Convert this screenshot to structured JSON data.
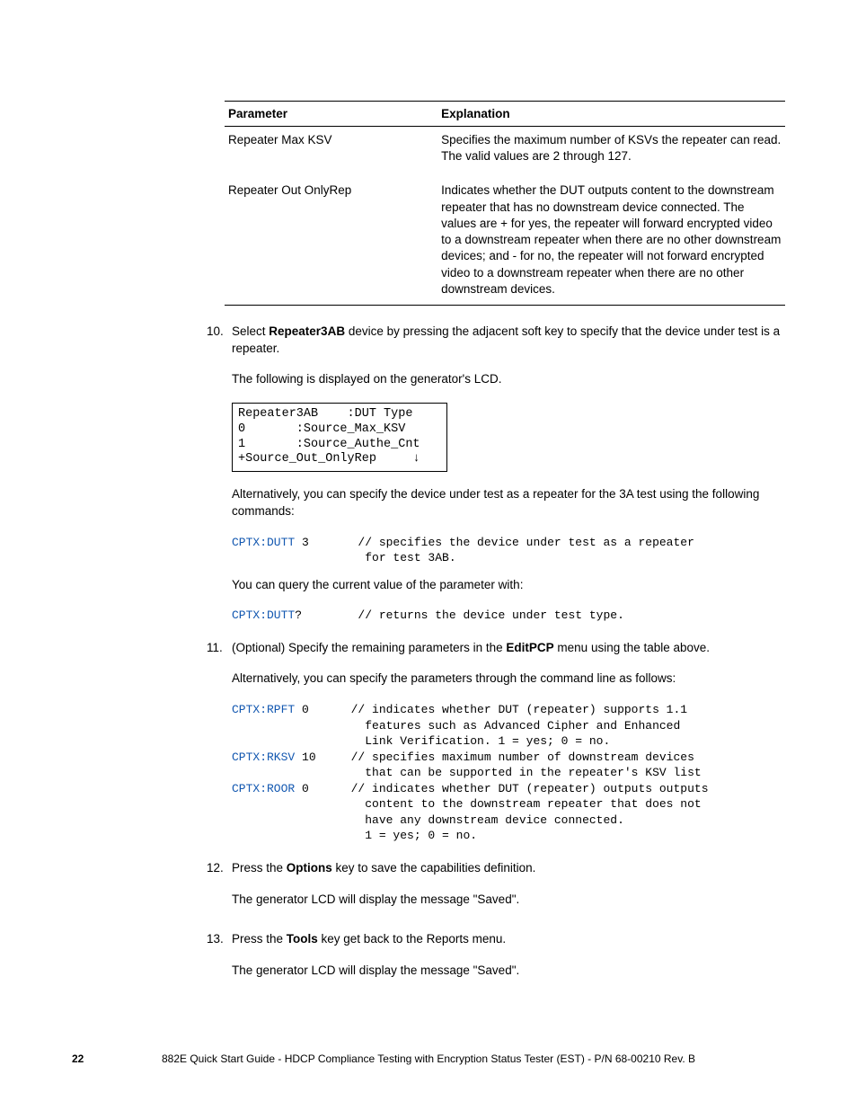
{
  "table": {
    "hdr_param": "Parameter",
    "hdr_expl": "Explanation",
    "r1_param": "Repeater Max KSV",
    "r1_expl": "Specifies the maximum number of KSVs the repeater can read. The valid values are 2 through 127.",
    "r2_param": "Repeater Out OnlyRep",
    "r2_expl": "Indicates whether the DUT outputs content to the downstream repeater that has no downstream device connected. The values are + for yes, the repeater will forward encrypted video to a downstream repeater when there are no other downstream devices; and - for no, the repeater will not forward encrypted video to a downstream repeater when there are no other downstream devices."
  },
  "s10": {
    "num": "10.",
    "p1a": "Select ",
    "p1b": "Repeater3AB",
    "p1c": " device by pressing the adjacent soft key to specify that the device under test is a repeater.",
    "p2": "The following is displayed on the generator's LCD.",
    "lcd": "Repeater3AB    :DUT Type\n0       :Source_Max_KSV\n1       :Source_Authe_Cnt\n+Source_Out_OnlyRep     ↓",
    "p3": "Alternatively, you can specify the device under test as a repeater for the 3A test using the following commands:",
    "cmd1_kw": "CPTX:DUTT",
    "cmd1_rest": " 3       // specifies the device under test as a repeater\n                   for test 3AB.",
    "p4": "You can query the current value of the parameter with:",
    "cmd2_kw": "CPTX:DUTT",
    "cmd2_rest": "?        // returns the device under test type."
  },
  "s11": {
    "num": "11.",
    "p1a": "(Optional) Specify the remaining parameters in the ",
    "p1b": "EditPCP",
    "p1c": " menu using the table above.",
    "p2": "Alternatively, you can specify the parameters through the command line as follows:",
    "cmd1_kw": "CPTX:RPFT",
    "cmd1_rest": " 0      // indicates whether DUT (repeater) supports 1.1\n                   features such as Advanced Cipher and Enhanced\n                   Link Verification. 1 = yes; 0 = no.",
    "cmd2_kw": "CPTX:RKSV",
    "cmd2_rest": " 10     // specifies maximum number of downstream devices\n                   that can be supported in the repeater's KSV list",
    "cmd3_kw": "CPTX:ROOR",
    "cmd3_rest": " 0      // indicates whether DUT (repeater) outputs outputs\n                   content to the downstream repeater that does not\n                   have any downstream device connected.\n                   1 = yes; 0 = no."
  },
  "s12": {
    "num": "12.",
    "p1a": "Press the ",
    "p1b": "Options",
    "p1c": " key to save the capabilities definition.",
    "p2": "The generator LCD will display the message \"Saved\"."
  },
  "s13": {
    "num": "13.",
    "p1a": "Press the ",
    "p1b": "Tools",
    "p1c": " key get back to the Reports menu.",
    "p2": "The generator LCD will display the message \"Saved\"."
  },
  "footer": {
    "page": "22",
    "text": "882E Quick Start Guide - HDCP Compliance Testing with Encryption Status Tester (EST)    -   P/N 68-00210 Rev. B"
  }
}
